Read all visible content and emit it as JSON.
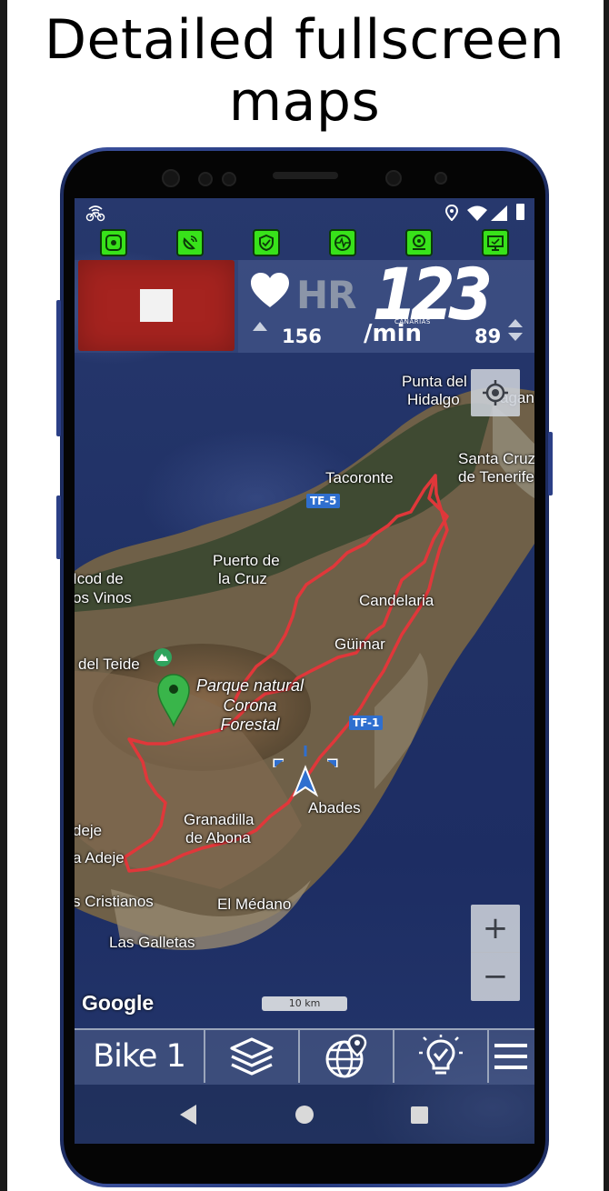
{
  "headline": {
    "line1": "Detailed fullscreen",
    "line2": "maps"
  },
  "statusbar": {
    "left_icon": "bike-wifi-icon",
    "right_icons": [
      "location-icon",
      "wifi-icon",
      "signal-icon",
      "battery-icon"
    ]
  },
  "top_toolbar": {
    "accent": "#38e21a",
    "icons": [
      "target-icon",
      "satellite-dish-icon",
      "shield-icon",
      "heart-pulse-icon",
      "gps-tracker-icon",
      "monitor-icon"
    ]
  },
  "stop_button": {
    "color": "#a5231f"
  },
  "hr_widget": {
    "label": "HR",
    "value": "123",
    "unit": "/min",
    "min": "156",
    "max": "89",
    "watermark": "CANARIAS"
  },
  "map": {
    "labels": {
      "punta": "Punta del",
      "hidalgo": "Hidalgo",
      "agan": "agan",
      "santa_cruz": "Santa Cruz",
      "de_tenerife": "de Tenerife",
      "tacoronte": "Tacoronte",
      "tf5": "TF-5",
      "puerto": "Puerto de",
      "la_cruz": "la Cruz",
      "icod": "Icod de",
      "los_vinos": "os Vinos",
      "candelaria": "Candelaria",
      "guimar": "Güimar",
      "teide": "del Teide",
      "parque1": "Parque natural",
      "parque2": "Corona",
      "parque3": "Forestal",
      "tf1": "TF-1",
      "abades": "Abades",
      "granadilla": "Granadilla",
      "de_abona": "de Abona",
      "adeje": "deje",
      "la_adeje": "a Adeje",
      "cristianos": "s Cristianos",
      "medano": "El Médano",
      "galletas": "Las Galletas"
    },
    "route_color": "#e0373a",
    "google": "Google",
    "scale": "10 km",
    "zoom_in": "+",
    "zoom_out": "−"
  },
  "bottombar": {
    "profile": "Bike 1",
    "icons": [
      "layers-icon",
      "globe-pin-icon",
      "lightbulb-icon",
      "menu-icon"
    ]
  }
}
